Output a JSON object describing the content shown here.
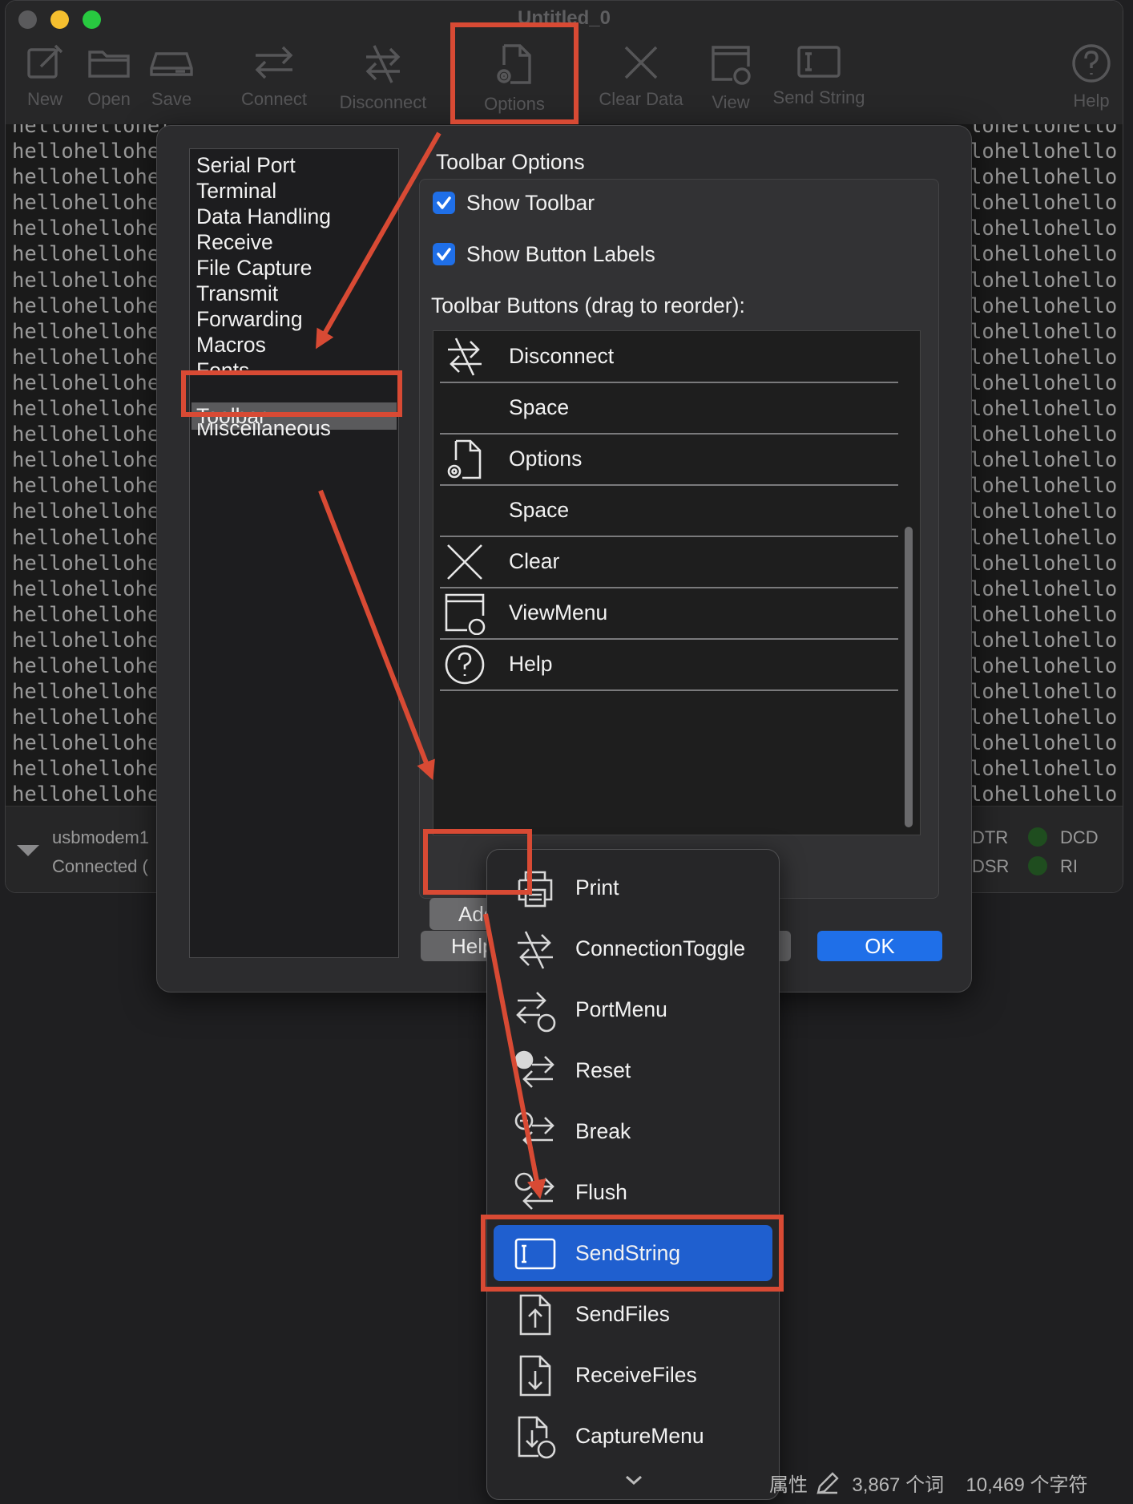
{
  "window": {
    "title": "Untitled_0",
    "traffic_lights": {
      "close": "#5a5a5c",
      "minimize": "#f5bf2f",
      "maximize": "#28c940"
    }
  },
  "toolbar": {
    "buttons": [
      {
        "label": "New",
        "icon": "new-document-icon"
      },
      {
        "label": "Open",
        "icon": "folder-icon"
      },
      {
        "label": "Save",
        "icon": "drive-icon"
      },
      {
        "label": "Connect",
        "icon": "connect-arrows-icon"
      },
      {
        "label": "Disconnect",
        "icon": "disconnect-arrows-icon"
      },
      {
        "label": "Options",
        "icon": "document-gear-icon"
      },
      {
        "label": "Clear Data",
        "icon": "x-icon"
      },
      {
        "label": "View",
        "icon": "window-more-icon"
      },
      {
        "label": "Send String",
        "icon": "text-cursor-box-icon"
      },
      {
        "label": "Help",
        "icon": "question-circle-icon"
      }
    ]
  },
  "terminal": {
    "left_fragment": "hellohellohel",
    "right_fragment": "lohellohello",
    "top_partial_left": "hellohellohel",
    "top_partial_right": "lohellohello"
  },
  "status": {
    "port_name": "usbmodem1",
    "connection": "Connected (",
    "signals": [
      {
        "label": "DTR",
        "color": "#2a5a2a"
      },
      {
        "label": "DCD",
        "color": "#1f4d1f"
      },
      {
        "label": "DSR",
        "color": "#2a5a2a"
      },
      {
        "label": "RI",
        "color": "#1f4d1f"
      }
    ]
  },
  "dialog": {
    "categories": [
      "Serial Port",
      "Terminal",
      "Data Handling",
      "Receive",
      "File Capture",
      "Transmit",
      "Forwarding",
      "Macros",
      "Fonts",
      "Toolbar",
      "Miscellaneous"
    ],
    "selected_category": "Toolbar",
    "section_title": "Toolbar Options",
    "show_toolbar": {
      "label": "Show Toolbar",
      "checked": true
    },
    "show_button_labels": {
      "label": "Show Button Labels",
      "checked": true
    },
    "buttons_list_label": "Toolbar Buttons (drag to reorder):",
    "buttons_list": [
      {
        "label": "Disconnect",
        "icon": "disconnect-arrows-icon"
      },
      {
        "label": "Space",
        "icon": ""
      },
      {
        "label": "Options",
        "icon": "document-gear-icon"
      },
      {
        "label": "Space",
        "icon": ""
      },
      {
        "label": "Clear",
        "icon": "x-icon"
      },
      {
        "label": "ViewMenu",
        "icon": "window-more-icon"
      },
      {
        "label": "Help",
        "icon": "question-circle-icon"
      }
    ],
    "add_button": "Add",
    "help_button": "Help",
    "ok_button": "OK",
    "accent": "#1f6fe8"
  },
  "add_menu": {
    "items": [
      {
        "label": "Print",
        "icon": "printer-icon"
      },
      {
        "label": "ConnectionToggle",
        "icon": "disconnect-arrows-icon"
      },
      {
        "label": "PortMenu",
        "icon": "arrows-more-icon"
      },
      {
        "label": "Reset",
        "icon": "arrows-alert-icon"
      },
      {
        "label": "Break",
        "icon": "arrows-stop-icon"
      },
      {
        "label": "Flush",
        "icon": "arrows-flush-icon"
      },
      {
        "label": "SendString",
        "icon": "text-cursor-box-icon"
      },
      {
        "label": "SendFiles",
        "icon": "document-upload-icon"
      },
      {
        "label": "ReceiveFiles",
        "icon": "document-download-icon"
      },
      {
        "label": "CaptureMenu",
        "icon": "document-capture-icon"
      }
    ],
    "selected": "SendString",
    "more_indicator": "chevron-down-icon"
  },
  "word_count": {
    "properties": "属性",
    "words": "3,867 个词",
    "chars": "10,469 个字符"
  },
  "annotation_color": "#d84a34"
}
